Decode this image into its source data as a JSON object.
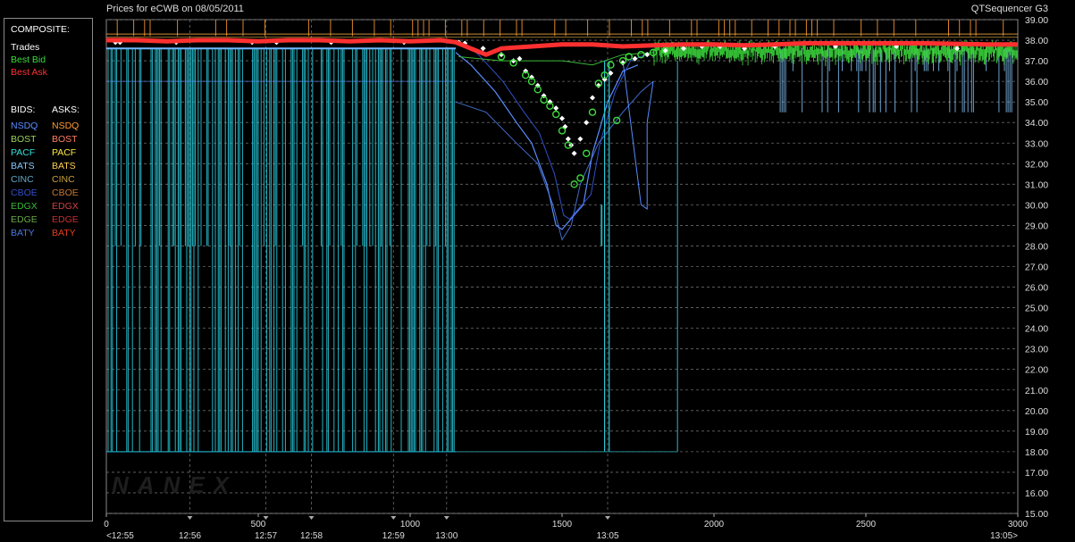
{
  "header": {
    "title": "Prices for  eCWB  on  08/05/2011",
    "app": "QTSequencer G3"
  },
  "legend": {
    "composite_label": "COMPOSITE:",
    "composite_items": [
      {
        "label": "Trades",
        "color": "#ffffff"
      },
      {
        "label": "Best Bid",
        "color": "#3cdc3c"
      },
      {
        "label": "Best Ask",
        "color": "#ff3030"
      }
    ],
    "bids_label": "BIDS:",
    "asks_label": "ASKS:",
    "bids": [
      {
        "label": "NSDQ",
        "color": "#5a8cff"
      },
      {
        "label": "BOST",
        "color": "#9ad35a"
      },
      {
        "label": "PACF",
        "color": "#30e0d8"
      },
      {
        "label": "BATS",
        "color": "#86c8ff"
      },
      {
        "label": "CINC",
        "color": "#60a8c8"
      },
      {
        "label": "CBOE",
        "color": "#3050c8"
      },
      {
        "label": "EDGX",
        "color": "#38b838"
      },
      {
        "label": "EDGE",
        "color": "#6aa84a"
      },
      {
        "label": "BATY",
        "color": "#4a78e0"
      }
    ],
    "asks": [
      {
        "label": "NSDQ",
        "color": "#ff9a30"
      },
      {
        "label": "BOST",
        "color": "#ff8060"
      },
      {
        "label": "PACF",
        "color": "#ffe840"
      },
      {
        "label": "BATS",
        "color": "#ffd050"
      },
      {
        "label": "CINC",
        "color": "#c8a040"
      },
      {
        "label": "CBOE",
        "color": "#c87830"
      },
      {
        "label": "EDGX",
        "color": "#d04040"
      },
      {
        "label": "EDGE",
        "color": "#c83030"
      },
      {
        "label": "BATY",
        "color": "#e04020"
      }
    ]
  },
  "watermark": "NANEX",
  "chart_data": {
    "type": "line",
    "xlim": [
      0,
      3000
    ],
    "ylim": [
      15.0,
      39.0
    ],
    "x_ticks": [
      0,
      500,
      1000,
      1500,
      2000,
      2500,
      3000
    ],
    "x_tick_labels": [
      "0",
      "500",
      "1000",
      "1500",
      "2000",
      "2500",
      "3000"
    ],
    "time_ticks": [
      {
        "x": 0,
        "label": "<12:55"
      },
      {
        "x": 275,
        "label": "12:56"
      },
      {
        "x": 525,
        "label": "12:57"
      },
      {
        "x": 675,
        "label": "12:58"
      },
      {
        "x": 945,
        "label": "12:59"
      },
      {
        "x": 1120,
        "label": "13:00"
      },
      {
        "x": 1650,
        "label": "13:05"
      },
      {
        "x": 3000,
        "label": "13:05>"
      }
    ],
    "y_ticks": [
      15,
      16,
      17,
      18,
      19,
      20,
      21,
      22,
      23,
      24,
      25,
      26,
      27,
      28,
      29,
      30,
      31,
      32,
      33,
      34,
      35,
      36,
      37,
      38,
      39
    ],
    "y_tick_labels": [
      "15.00",
      "16.00",
      "17.00",
      "18.00",
      "19.00",
      "20.00",
      "21.00",
      "22.00",
      "23.00",
      "24.00",
      "25.00",
      "26.00",
      "27.00",
      "28.00",
      "29.00",
      "30.00",
      "31.00",
      "32.00",
      "33.00",
      "34.00",
      "35.00",
      "36.00",
      "37.00",
      "38.00",
      "39.00"
    ],
    "grid": true,
    "series": [
      {
        "name": "Trades",
        "color": "#ffffff",
        "mode": "points",
        "x": [
          30,
          45,
          230,
          480,
          560,
          740,
          980,
          1160,
          1180,
          1240,
          1300,
          1360,
          1340,
          1380,
          1400,
          1420,
          1440,
          1460,
          1480,
          1500,
          1510,
          1520,
          1530,
          1540,
          1560,
          1580,
          1600,
          1620,
          1640,
          1660,
          1700,
          1740,
          1780,
          1840,
          1900,
          1960,
          2020,
          2100,
          2200,
          2400,
          2600,
          2800
        ],
        "values": [
          37.9,
          37.9,
          37.9,
          37.9,
          37.9,
          37.9,
          37.9,
          37.9,
          37.85,
          37.6,
          37.3,
          37.1,
          37.0,
          36.5,
          36.2,
          35.8,
          35.3,
          35.0,
          34.7,
          34.2,
          33.8,
          33.2,
          32.9,
          32.5,
          33.2,
          34.0,
          35.2,
          35.8,
          36.1,
          36.4,
          36.9,
          37.1,
          37.3,
          37.5,
          37.6,
          37.7,
          37.7,
          37.6,
          37.7,
          37.7,
          37.7,
          37.6
        ]
      },
      {
        "name": "Best Bid",
        "color": "#3cdc3c",
        "mode": "circles",
        "x": [
          1300,
          1340,
          1380,
          1400,
          1420,
          1440,
          1460,
          1480,
          1500,
          1520,
          1540,
          1560,
          1580,
          1600,
          1620,
          1640,
          1660,
          1680,
          1700,
          1720,
          1760,
          1800,
          1840
        ],
        "values": [
          37.2,
          36.9,
          36.3,
          36.0,
          35.6,
          35.1,
          34.8,
          34.4,
          33.6,
          32.9,
          31.0,
          31.3,
          32.5,
          34.5,
          35.9,
          36.3,
          36.8,
          34.1,
          37.0,
          37.2,
          37.3,
          37.4,
          37.5
        ]
      },
      {
        "name": "Best Ask",
        "color": "#ff3030",
        "mode": "dense",
        "x": [
          0,
          100,
          200,
          300,
          400,
          500,
          600,
          700,
          800,
          900,
          1000,
          1100,
          1150,
          1200,
          1250,
          1300,
          1400,
          1500,
          1600,
          1700,
          1800,
          1900,
          2000,
          2100,
          2200,
          2300,
          2500,
          2700,
          2900,
          3000
        ],
        "values": [
          38.0,
          38.0,
          37.95,
          38.0,
          38.0,
          37.95,
          38.0,
          38.0,
          37.95,
          38.0,
          37.95,
          38.0,
          37.9,
          37.6,
          37.3,
          37.6,
          37.7,
          37.8,
          37.8,
          37.7,
          37.75,
          37.8,
          37.8,
          37.75,
          37.8,
          37.85,
          37.85,
          37.85,
          37.8,
          37.8
        ]
      }
    ]
  }
}
